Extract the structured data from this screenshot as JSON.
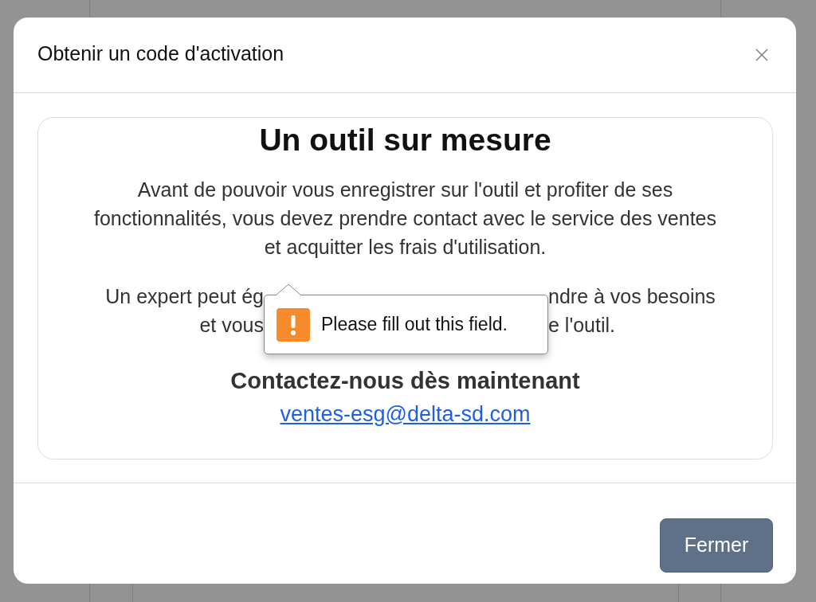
{
  "dialog": {
    "title": "Obtenir un code d'activation",
    "card": {
      "heading": "Un outil sur mesure",
      "paragraph": "Avant de pouvoir vous enregistrer sur l'outil et profiter de ses fonctionnalités, vous devez prendre contact avec le service des ventes et acquitter les frais d'utilisation.",
      "covered_lines": [
        {
          "left": "Un expert peut ég",
          "right": "ndre à vos besoins"
        },
        {
          "left": "et vous",
          "right": "e l'outil."
        }
      ],
      "contact_heading": "Contactez-nous dès maintenant",
      "email": "ventes-esg@delta-sd.com"
    },
    "tooltip": {
      "message": "Please fill out this field."
    },
    "buttons": [
      {
        "label": "Fermer"
      }
    ]
  }
}
